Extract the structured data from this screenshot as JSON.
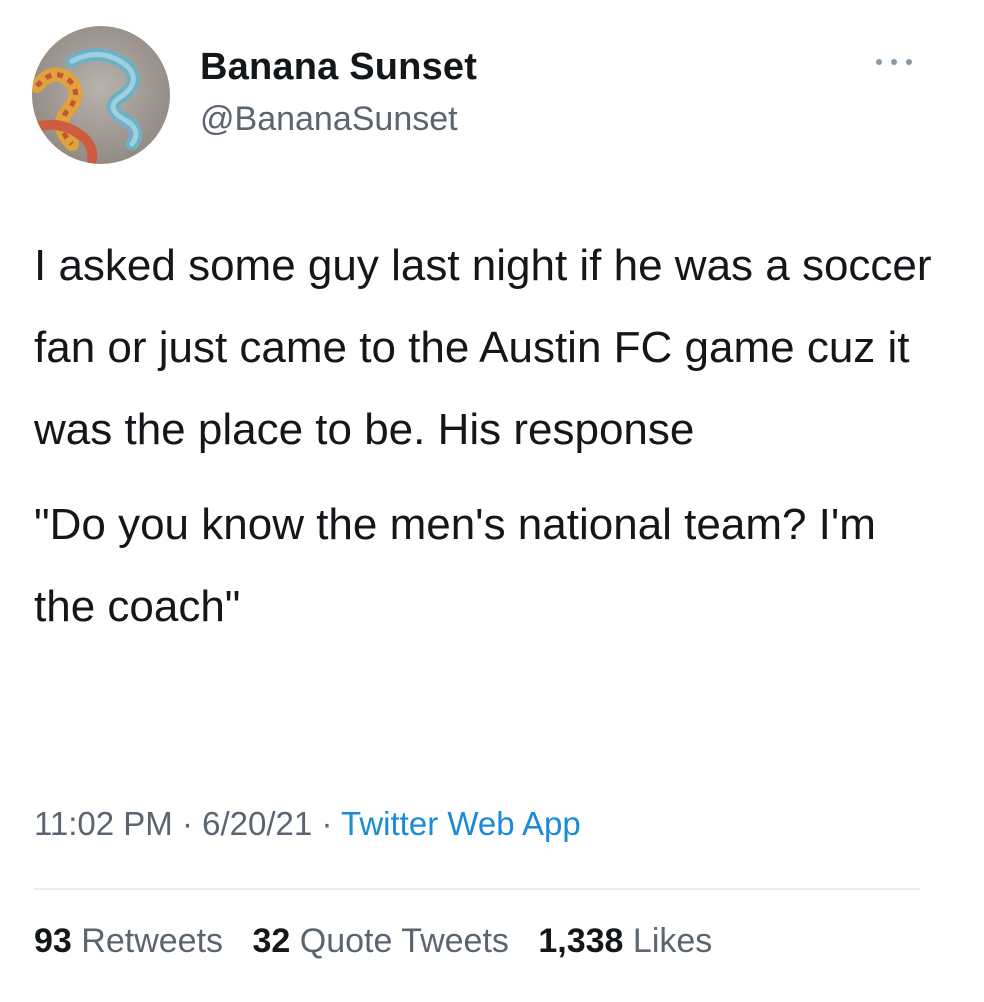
{
  "user": {
    "display_name": "Banana Sunset",
    "handle": "@BananaSunset"
  },
  "tweet": {
    "paragraphs": [
      "I asked some guy last night if he was a soccer fan or just came to the Austin FC game cuz it was the place to be. His response",
      "\"Do you know the men's national team? I'm the coach\""
    ],
    "time": "11:02 PM",
    "date": "6/20/21",
    "separator": "·",
    "source": "Twitter Web App"
  },
  "stats": {
    "retweets_count": "93",
    "retweets_label": "Retweets",
    "quotes_count": "32",
    "quotes_label": "Quote Tweets",
    "likes_count": "1,338",
    "likes_label": "Likes"
  },
  "icons": {
    "more": "more-options-icon"
  },
  "colors": {
    "link": "#1b8bd6",
    "secondary_text": "#5b6570",
    "primary_text": "#14171a"
  }
}
